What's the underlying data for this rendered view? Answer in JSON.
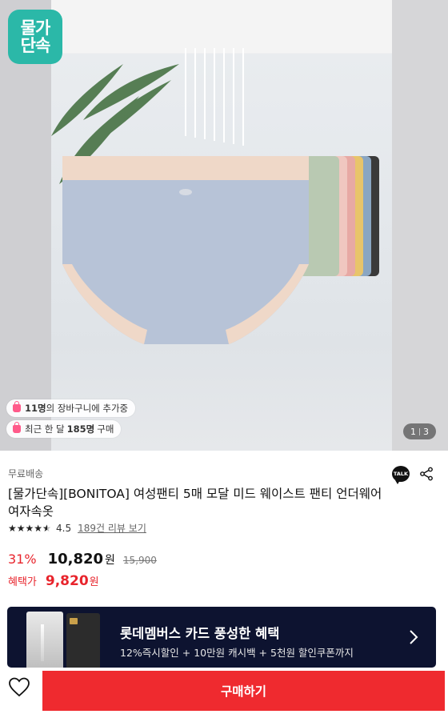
{
  "logo": {
    "line1": "물가",
    "line2": "단속"
  },
  "chips": [
    {
      "count": "11명",
      "text": "의 장바구니에 추가중"
    },
    {
      "prefix": "최근 한 달 ",
      "count": "185명",
      "suffix": " 구매"
    }
  ],
  "pager": {
    "current": "1",
    "total": "3"
  },
  "product": {
    "shipping": "무료배송",
    "title": "[물가단속][BONITOA] 여성팬티 5매 모달 미드 웨이스트 팬티 언더웨어 여자속옷",
    "rating": "4.5",
    "rating_value": 4.5,
    "reviews": "189건 리뷰 보기"
  },
  "pricing": {
    "discount": "31%",
    "price": "10,820",
    "won": "원",
    "original": "15,900",
    "benefit_label": "혜택가",
    "benefit_price": "9,820",
    "benefit_won": "원"
  },
  "banner": {
    "title": "롯데멤버스 카드 풍성한 혜택",
    "subtitle": "12%즉시할인 + 10만원 캐시백 + 5천원 할인쿠폰까지"
  },
  "icons": {
    "talk": "TALK",
    "share": "share-icon",
    "heart": "heart-icon",
    "chevron": "chevron-right-icon"
  },
  "bottom": {
    "buy_label": "구매하기"
  },
  "colors": {
    "accent": "#ef2a2f",
    "brand_badge": "#2bb8a8",
    "banner_bg": "#0d1330",
    "discount": "#e8242c"
  }
}
